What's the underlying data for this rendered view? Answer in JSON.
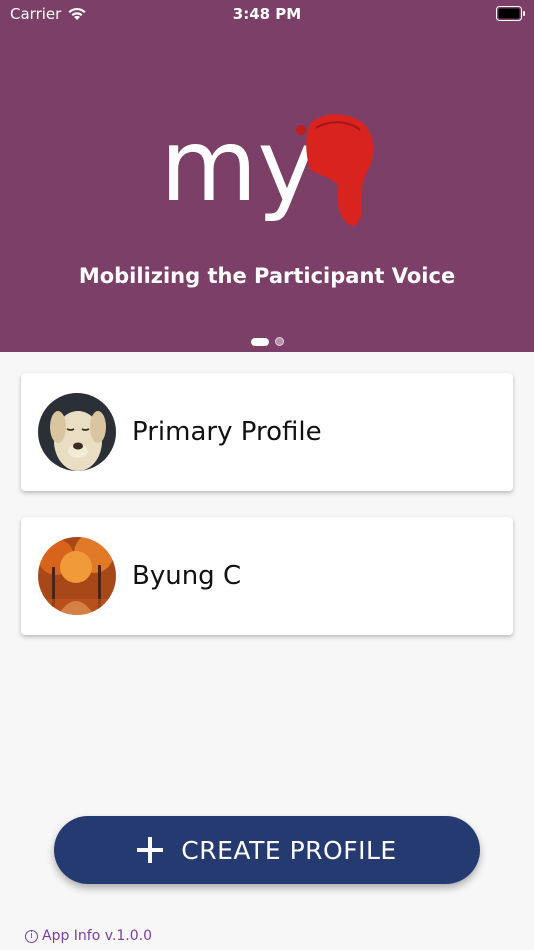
{
  "status_bar": {
    "carrier": "Carrier",
    "time": "3:48 PM",
    "wifi_icon": "wifi-icon",
    "battery_icon": "battery-icon"
  },
  "hero": {
    "logo_text": "my",
    "tagline": "Mobilizing the Participant Voice",
    "pager": {
      "pages": 2,
      "active_index": 0
    },
    "background_color": "#7c3f67"
  },
  "profiles": [
    {
      "name": "Primary Profile",
      "avatar": "dog-photo"
    },
    {
      "name": "Byung C",
      "avatar": "autumn-forest-photo"
    }
  ],
  "create_button": {
    "label": "CREATE PROFILE",
    "icon": "plus-icon",
    "color": "#253a70"
  },
  "footer": {
    "app_info": "App Info v.1.0.0",
    "icon": "info-icon"
  }
}
